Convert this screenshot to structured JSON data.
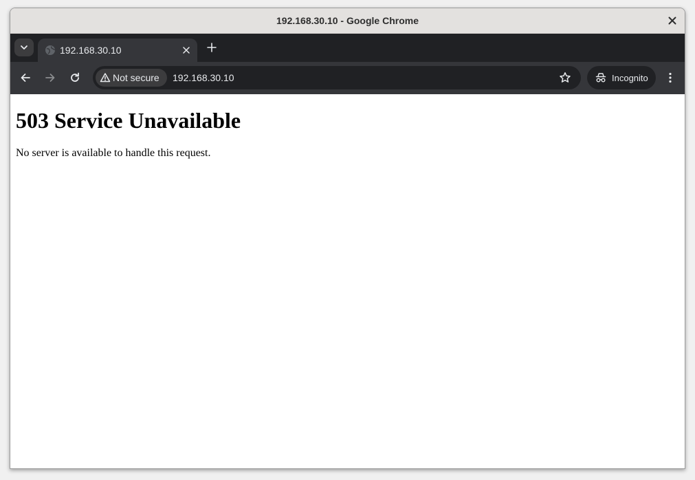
{
  "window": {
    "title": "192.168.30.10 - Google Chrome"
  },
  "tabs": [
    {
      "title": "192.168.30.10",
      "active": true
    }
  ],
  "toolbar": {
    "security_chip": "Not secure",
    "url": "192.168.30.10",
    "incognito_label": "Incognito"
  },
  "icons": {
    "back": "back-arrow-icon",
    "forward": "forward-arrow-icon",
    "reload": "reload-icon",
    "warning": "warning-triangle-icon",
    "bookmark": "star-icon",
    "incognito": "incognito-icon",
    "menu": "kebab-menu-icon",
    "close": "close-icon",
    "new_tab": "plus-icon",
    "tab_search": "chevron-down-icon",
    "favicon": "globe-icon"
  },
  "colors": {
    "titlebar": "#e3e1df",
    "tabstrip": "#202124",
    "toolbar": "#35363a",
    "omnibox": "#202124"
  },
  "page": {
    "heading": "503 Service Unavailable",
    "message": "No server is available to handle this request."
  }
}
